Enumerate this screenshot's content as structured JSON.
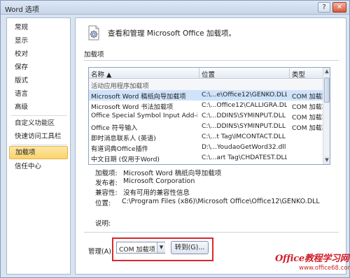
{
  "window": {
    "title": "Word 选项",
    "help_glyph": "?",
    "close_glyph": "✕"
  },
  "sidebar": {
    "items": [
      {
        "label": "常规",
        "active": false
      },
      {
        "label": "显示",
        "active": false
      },
      {
        "label": "校对",
        "active": false
      },
      {
        "label": "保存",
        "active": false
      },
      {
        "label": "版式",
        "active": false
      },
      {
        "label": "语言",
        "active": false
      },
      {
        "label": "高级",
        "active": false
      },
      {
        "label": "自定义功能区",
        "active": false
      },
      {
        "label": "快速访问工具栏",
        "active": false
      },
      {
        "label": "加载项",
        "active": true
      },
      {
        "label": "信任中心",
        "active": false
      }
    ]
  },
  "main": {
    "header_icon": "addins-gear-icon",
    "header_text": "查看和管理 Microsoft Office 加载项。",
    "section_title": "加载项",
    "grid": {
      "columns": [
        "名称 ▲",
        "位置",
        "类型"
      ],
      "group_label": "活动应用程序加载项",
      "rows": [
        {
          "name": "Microsoft Word 稿纸向导加载项",
          "location": "C:\\...e\\Office12\\GENKO.DLL",
          "type": "COM 加载项",
          "selected": true
        },
        {
          "name": "Microsoft Word 书法加载项",
          "location": "C:\\...Office12\\CALLIGRA.DLL",
          "type": "COM 加载项",
          "selected": false
        },
        {
          "name": "Office Special Symbol Input Add-in",
          "location": "C:\\...DDINS\\SYMINPUT.DLL",
          "type": "COM 加载项",
          "selected": false
        },
        {
          "name": "Office 符号输入",
          "location": "C:\\...DDINS\\SYMINPUT.DLL",
          "type": "COM 加载项",
          "selected": false
        },
        {
          "name": "即时消息联系人 (英语)",
          "location": "C:\\...t Tag\\IMCONTACT.DLL",
          "type": "",
          "selected": false
        },
        {
          "name": "有道词典Office插件",
          "location": "D:\\...YoudaoGetWord32.dll",
          "type": "",
          "selected": false
        },
        {
          "name": "中文日期 (仅用于Word)",
          "location": "C:\\...art Tag\\CHDATEST.DLL",
          "type": "",
          "selected": false
        }
      ]
    },
    "details": {
      "addin_label": "加载项:",
      "addin_value": "Microsoft Word 稿纸向导加载项",
      "publisher_label": "发布者:",
      "publisher_value": "Microsoft Corporation",
      "compat_label": "兼容性:",
      "compat_value": "没有可用的兼容性信息",
      "location_label": "位置:",
      "location_value": "C:\\Program Files (x86)\\Microsoft Office\\Office12\\GENKO.DLL",
      "desc_label": "说明:"
    },
    "manage": {
      "label": "管理(A):",
      "selected": "COM 加载项",
      "go_button": "转到(G)..."
    }
  },
  "watermark": {
    "main": "Office教程学习网",
    "url": "www.office68.com"
  }
}
